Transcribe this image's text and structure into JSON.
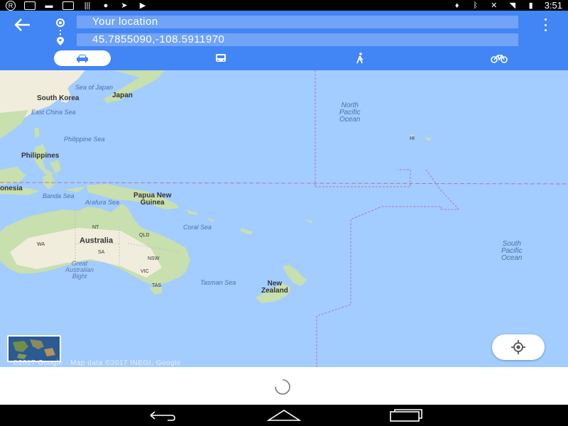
{
  "status_bar": {
    "time": "3:51",
    "left_icons": [
      "registered-icon",
      "download-icon",
      "print-icon",
      "news-icon",
      "barcode-icon",
      "alert-icon",
      "send-icon",
      "video-icon"
    ],
    "right_icons": [
      "location-icon",
      "bluetooth-icon",
      "mute-icon",
      "wifi-icon",
      "battery-icon"
    ]
  },
  "directions": {
    "origin": "Your location",
    "destination": "45.7855090,-108.5911970",
    "modes": [
      {
        "name": "drive",
        "icon": "car-icon",
        "active": true
      },
      {
        "name": "transit",
        "icon": "bus-icon",
        "active": false
      },
      {
        "name": "walk",
        "icon": "walk-icon",
        "active": false
      },
      {
        "name": "bicycle",
        "icon": "bike-icon",
        "active": false
      }
    ]
  },
  "map": {
    "countries": {
      "south_korea": "South Korea",
      "japan": "Japan",
      "philippines": "Philippines",
      "indonesia": "onesia",
      "png_line1": "Papua New",
      "png_line2": "Guinea",
      "australia": "Australia",
      "nz_line1": "New",
      "nz_line2": "Zealand"
    },
    "seas": {
      "sea_of_japan": "Sea of Japan",
      "east_china_sea": "East China Sea",
      "philippine_sea": "Philippine Sea",
      "banda_sea": "Banda Sea",
      "arafura_sea": "Arafura Sea",
      "coral_sea": "Coral Sea",
      "tasman_sea": "Tasman Sea"
    },
    "oceans": {
      "north_pacific": [
        "North",
        "Pacific",
        "Ocean"
      ],
      "south_pacific": [
        "South",
        "Pacific",
        "Ocean"
      ]
    },
    "states": {
      "wa": "WA",
      "nt": "NT",
      "sa": "SA",
      "qld": "QLD",
      "nsw": "NSW",
      "vic": "VIC",
      "tas": "TAS",
      "hi": "HI"
    },
    "region": [
      "Great",
      "Australian",
      "Bight"
    ],
    "copyright": "©2017 Google - Map data ©2017 INEGI, Google"
  },
  "colors": {
    "header_blue": "#4285f4",
    "water": "#a3ccff",
    "land": "#f1eddd",
    "land_green": "#c8dfae"
  }
}
